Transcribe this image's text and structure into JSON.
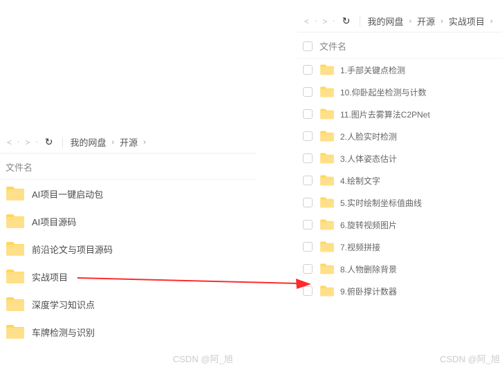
{
  "nav": {
    "back": "<",
    "forward": ">",
    "refresh": "↻"
  },
  "left": {
    "breadcrumb": [
      "我的网盘",
      "开源"
    ],
    "column_header": "文件名",
    "items": [
      "AI项目一键启动包",
      "AI项目源码",
      "前沿论文与项目源码",
      "实战项目",
      "深度学习知识点",
      "车牌检测与识别"
    ]
  },
  "right": {
    "breadcrumb": [
      "我的网盘",
      "开源",
      "实战项目"
    ],
    "column_header": "文件名",
    "items": [
      "1.手部关键点检测",
      "10.仰卧起坐检测与计数",
      "11.图片去雾算法C2PNet",
      "2.人脸实时检测",
      "3.人体姿态估计",
      "4.绘制文字",
      "5.实时绘制坐标值曲线",
      "6.旋转视频图片",
      "7.视频拼接",
      "8.人物删除背景",
      "9.俯卧撑计数器"
    ]
  },
  "watermark": "CSDN @阿_旭"
}
